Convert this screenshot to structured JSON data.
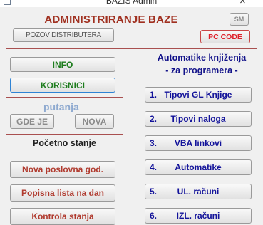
{
  "window": {
    "title": "BAZIS Admin",
    "close_glyph": "×",
    "icon": "app-window-icon"
  },
  "header": {
    "title": "ADMINISTRIRANJE BAZE",
    "corner_button": "SM",
    "poziv_button": "POZOV DISTRIBUTERA",
    "pc_code_button": "PC CODE"
  },
  "left": {
    "info_button": "INFO",
    "korisnici_button": "KORISNICI",
    "putanja_label": "putanja",
    "gde_je_button": "GDE JE",
    "nova_button": "NOVA",
    "pocetno_title": "Početno stanje",
    "nova_god_button": "Nova poslovna god.",
    "popisna_button": "Popisna lista na dan",
    "kontrola_button": "Kontrola stanja"
  },
  "right": {
    "title_line1": "Automatike knjiženja",
    "title_line2": "- za programera -",
    "items": [
      {
        "num": "1.",
        "label": "Tipovi GL Knjige"
      },
      {
        "num": "2.",
        "label": "Tipovi naloga"
      },
      {
        "num": "3.",
        "label": "VBA linkovi"
      },
      {
        "num": "4.",
        "label": "Automatike"
      },
      {
        "num": "5.",
        "label": "UL. računi"
      },
      {
        "num": "6.",
        "label": "IZL. računi"
      }
    ]
  },
  "colors": {
    "red_text": "#b03a2e",
    "green_text": "#1c7c1c",
    "blue_text": "#13139a",
    "divider": "#a95050",
    "focus_border": "#2f83d4"
  }
}
